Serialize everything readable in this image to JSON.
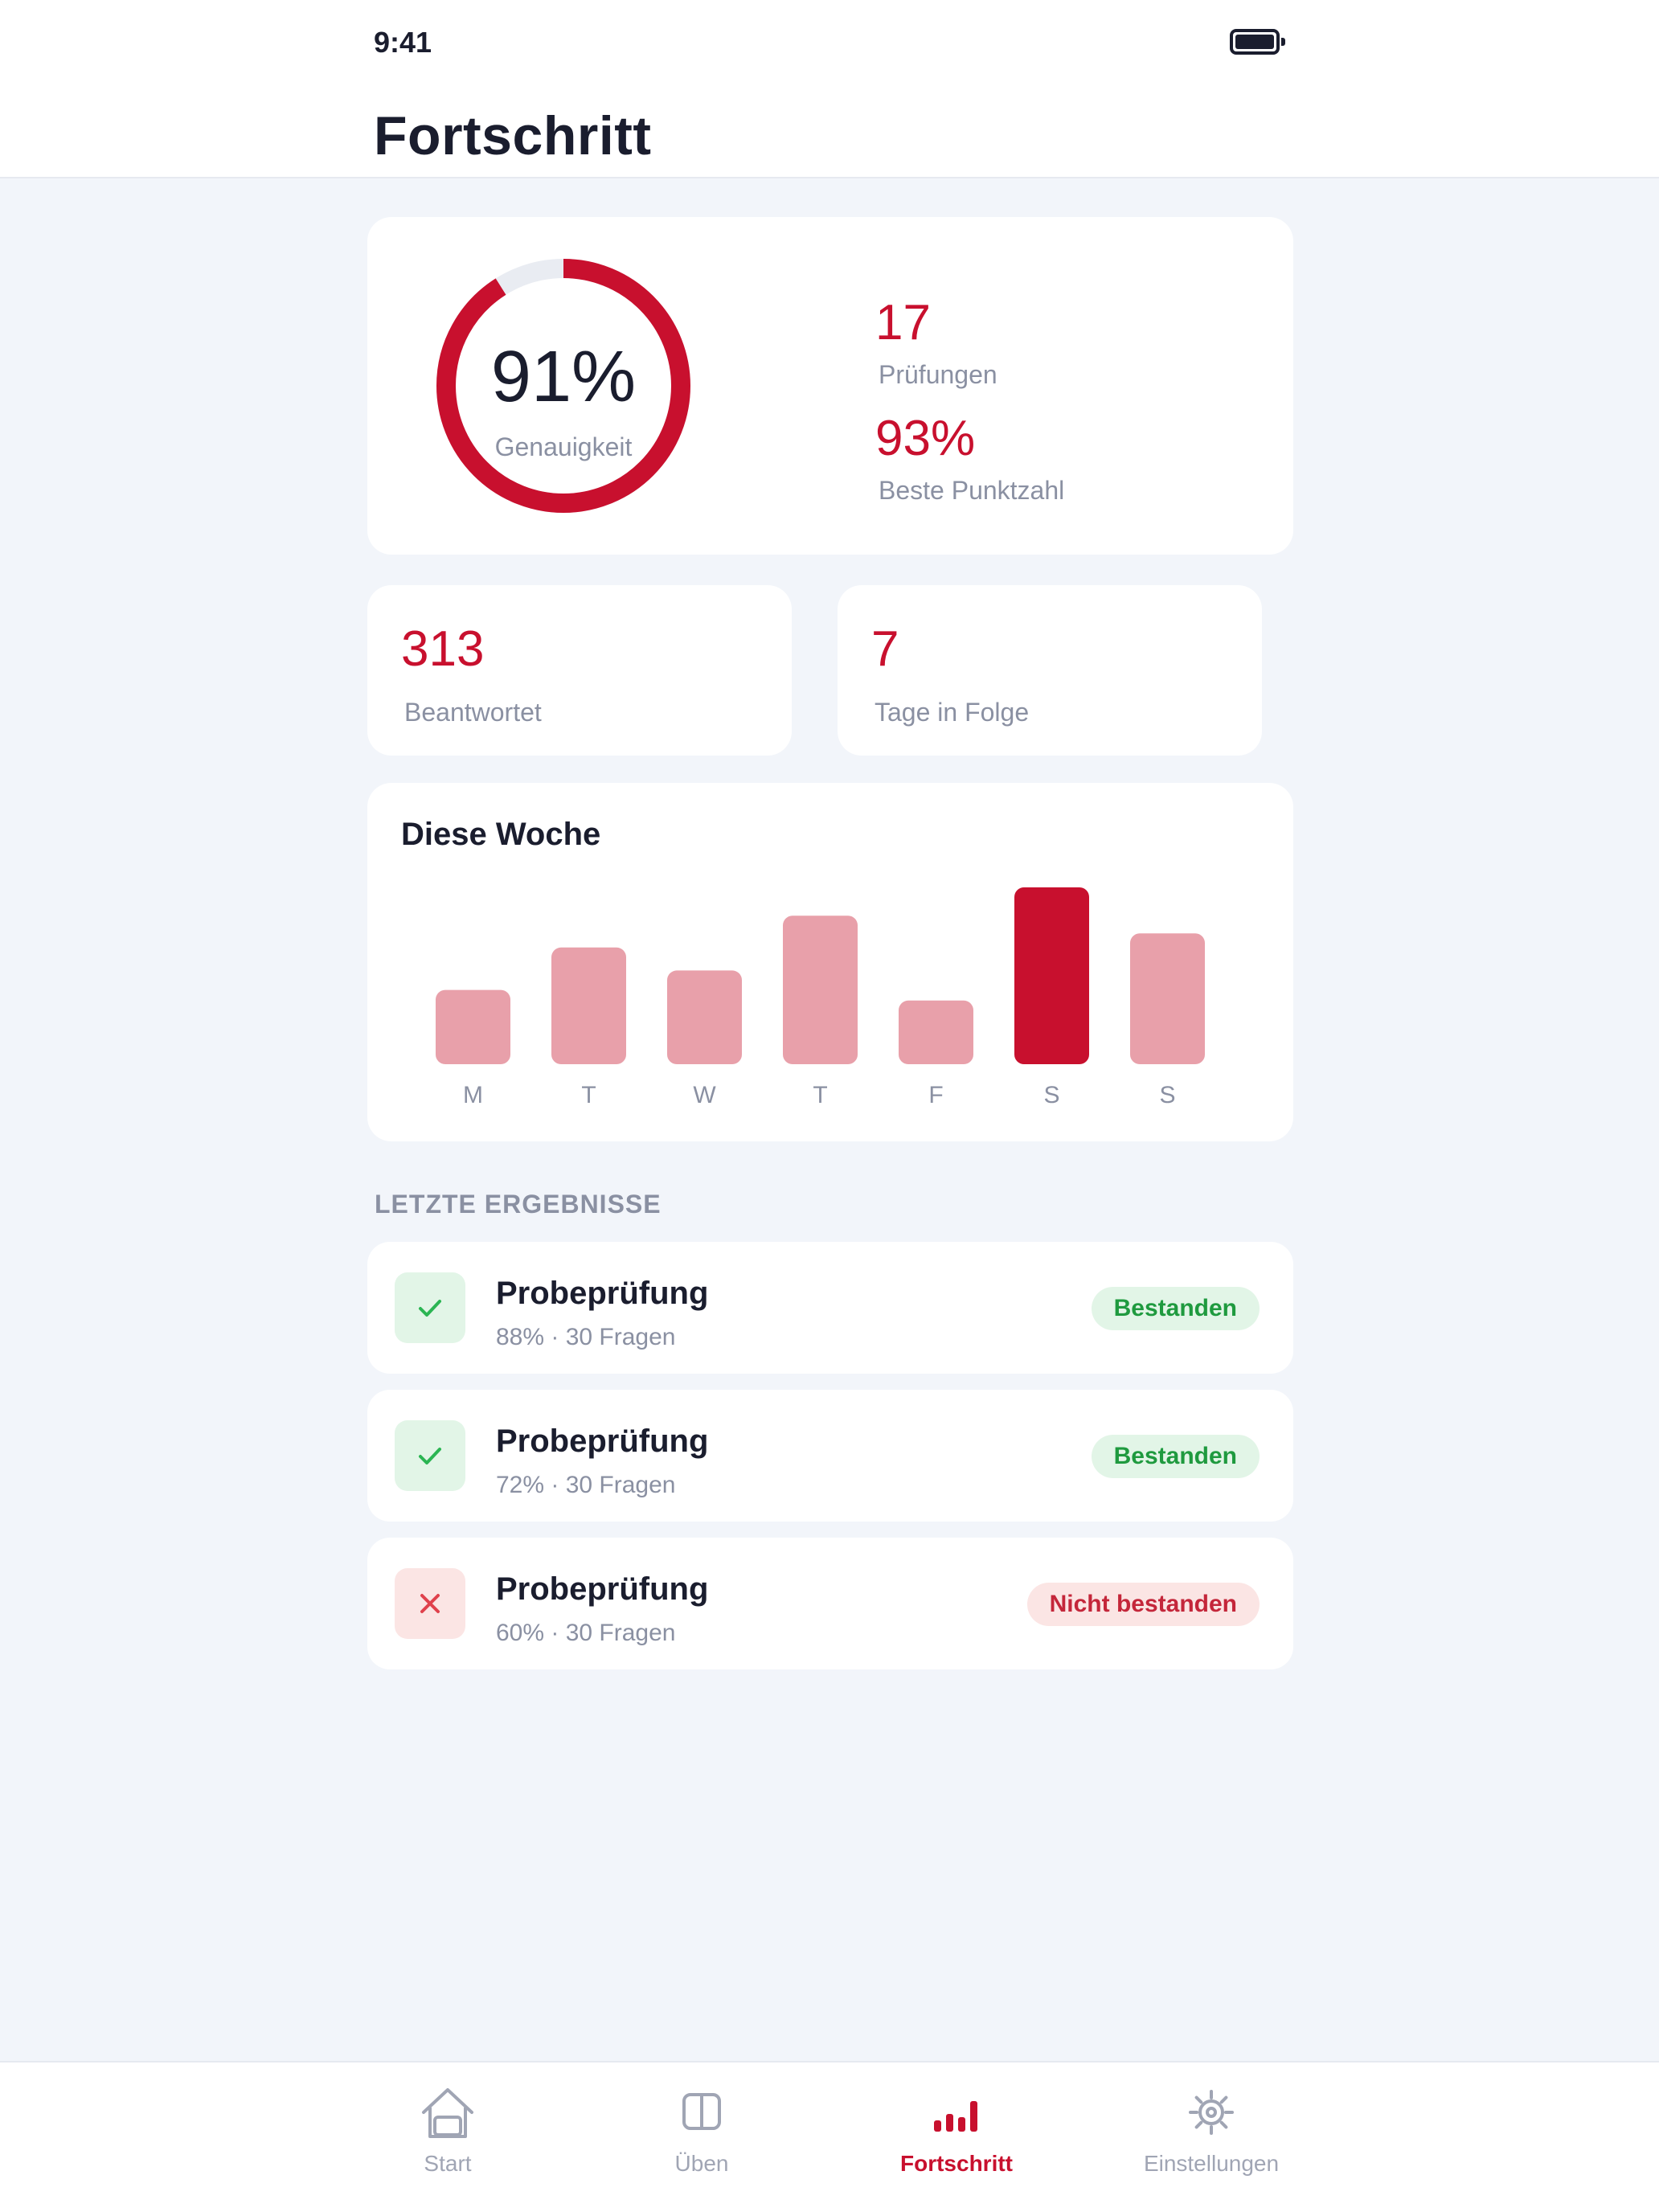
{
  "status_bar": {
    "time": "9:41"
  },
  "header": {
    "title": "Fortschritt"
  },
  "summary": {
    "accuracy_value": "91%",
    "accuracy_fraction": 0.91,
    "accuracy_label": "Genauigkeit",
    "exams_count": "17",
    "exams_label": "Prüfungen",
    "best_score": "93%",
    "best_score_label": "Beste Punktzahl"
  },
  "stats": {
    "answered_count": "313",
    "answered_label": "Beantwortet",
    "streak_count": "7",
    "streak_label": "Tage in Folge"
  },
  "chart_data": {
    "type": "bar",
    "title": "Diese Woche",
    "categories": [
      "M",
      "T",
      "W",
      "T",
      "F",
      "S",
      "S"
    ],
    "values": [
      42,
      66,
      53,
      84,
      36,
      100,
      74
    ],
    "ylim": [
      0,
      100
    ],
    "highlight_index": 5,
    "colors": {
      "bar": "#e8a0aa",
      "highlight": "#c8102e"
    }
  },
  "recent": {
    "heading": "LETZTE ERGEBNISSE",
    "results": [
      {
        "title": "Probeprüfung",
        "meta": "88% · 30 Fragen",
        "status": "Bestanden",
        "passed": true
      },
      {
        "title": "Probeprüfung",
        "meta": "72% · 30 Fragen",
        "status": "Bestanden",
        "passed": true
      },
      {
        "title": "Probeprüfung",
        "meta": "60% · 30 Fragen",
        "status": "Nicht bestanden",
        "passed": false
      }
    ]
  },
  "tabs": [
    {
      "label": "Start",
      "icon": "home-icon",
      "active": false
    },
    {
      "label": "Üben",
      "icon": "book-icon",
      "active": false
    },
    {
      "label": "Fortschritt",
      "icon": "bar-chart-icon",
      "active": true
    },
    {
      "label": "Einstellungen",
      "icon": "gear-icon",
      "active": false
    }
  ],
  "colors": {
    "accent": "#c8102e",
    "pass": "#1f9a3f",
    "fail": "#c4263a",
    "background": "#f2f5fa"
  }
}
